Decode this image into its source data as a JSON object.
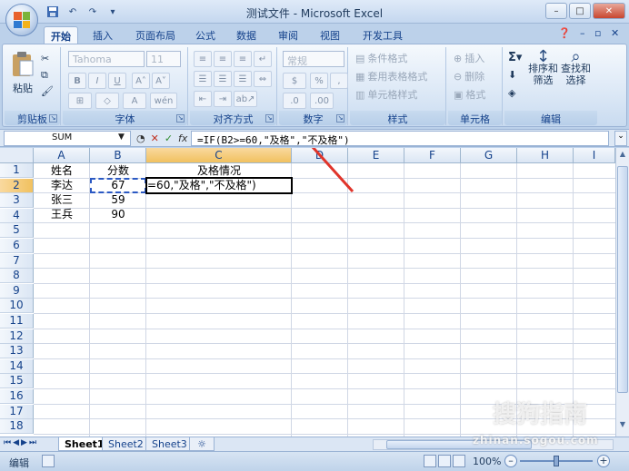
{
  "window": {
    "title": "测试文件 - Microsoft Excel"
  },
  "tabs": [
    "开始",
    "插入",
    "页面布局",
    "公式",
    "数据",
    "审阅",
    "视图",
    "开发工具"
  ],
  "ribbon": {
    "clipboard": {
      "label": "剪贴板",
      "paste": "粘贴"
    },
    "font": {
      "label": "字体",
      "name": "Tahoma",
      "size": "11"
    },
    "alignment": {
      "label": "对齐方式"
    },
    "number": {
      "label": "数字",
      "format": "常规"
    },
    "styles": {
      "label": "样式",
      "conditional": "条件格式",
      "table": "套用表格格式",
      "cell": "单元格样式"
    },
    "cells": {
      "label": "单元格",
      "insert": "插入",
      "delete": "删除",
      "format": "格式"
    },
    "editing": {
      "label": "编辑",
      "sort": "排序和",
      "filter": "筛选",
      "find": "查找和",
      "select": "选择"
    }
  },
  "formula_bar": {
    "name_box": "SUM",
    "formula": "=IF(B2>=60,\"及格\",\"不及格\")"
  },
  "columns": [
    "A",
    "B",
    "C",
    "D",
    "E",
    "F",
    "G",
    "H",
    "I"
  ],
  "rows": [
    "1",
    "2",
    "3",
    "4",
    "5",
    "6",
    "7",
    "8",
    "9",
    "10",
    "11",
    "12",
    "13",
    "14",
    "15",
    "16",
    "17",
    "18"
  ],
  "cells": {
    "A1": "姓名",
    "B1": "分数",
    "C1": "及格情况",
    "A2": "李达",
    "B2": "67",
    "C2": "=60,\"及格\",\"不及格\")",
    "A3": "张三",
    "B3": "59",
    "A4": "王兵",
    "B4": "90"
  },
  "sheets": [
    "Sheet1",
    "Sheet2",
    "Sheet3"
  ],
  "status": {
    "mode": "编辑",
    "zoom": "100%"
  },
  "watermark": {
    "text": "zhinan.sogou.com",
    "logo": "搜狗指南"
  },
  "colors": {
    "accent": "#15428b",
    "arrow": "#e0342a",
    "select_header": "#f1c15f"
  }
}
